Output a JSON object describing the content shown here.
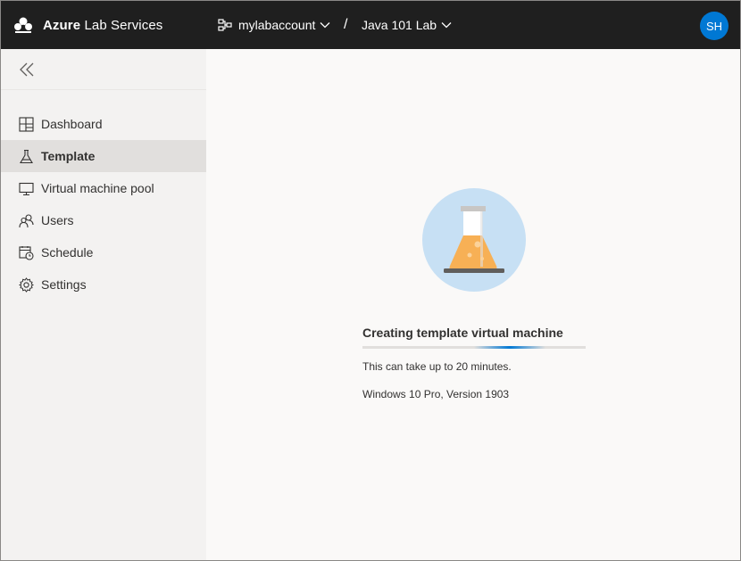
{
  "header": {
    "brand_bold": "Azure",
    "brand_rest": " Lab Services",
    "account": "mylabaccount",
    "separator": "/",
    "lab": "Java 101 Lab",
    "user_initials": "SH"
  },
  "sidebar": {
    "collapse_icon": "double-chevron-left-icon",
    "items": [
      {
        "label": "Dashboard",
        "icon": "dashboard-icon",
        "active": false
      },
      {
        "label": "Template",
        "icon": "flask-icon",
        "active": true
      },
      {
        "label": "Virtual machine pool",
        "icon": "monitor-icon",
        "active": false
      },
      {
        "label": "Users",
        "icon": "users-icon",
        "active": false
      },
      {
        "label": "Schedule",
        "icon": "calendar-clock-icon",
        "active": false
      },
      {
        "label": "Settings",
        "icon": "gear-icon",
        "active": false
      }
    ]
  },
  "main": {
    "status_title": "Creating template virtual machine",
    "progress": {
      "start_fraction": 0.5,
      "end_fraction": 0.82
    },
    "note": "This can take up to 20 minutes.",
    "os": "Windows 10 Pro, Version 1903"
  },
  "colors": {
    "topbar": "#1f1f1f",
    "accent": "#0078d4",
    "sidebar_bg": "#f3f2f1",
    "sidebar_active": "#e1dfdd",
    "main_bg": "#faf9f8",
    "flask_circle": "#c7e0f4",
    "flask_liquid": "#f7b055"
  }
}
